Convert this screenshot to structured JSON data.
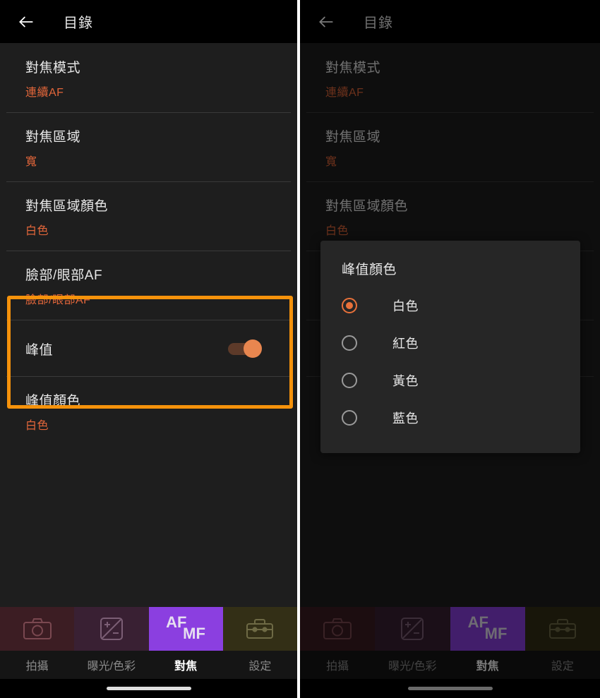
{
  "appbar": {
    "back_icon": "arrow-left-icon",
    "title": "目錄"
  },
  "settings_rows": [
    {
      "title": "對焦模式",
      "value": "連續AF",
      "type": "value"
    },
    {
      "title": "對焦區域",
      "value": "寬",
      "type": "value"
    },
    {
      "title": "對焦區域顏色",
      "value": "白色",
      "type": "value"
    },
    {
      "title": "臉部/眼部AF",
      "value": "臉部/眼部AF",
      "type": "value"
    },
    {
      "title": "峰值",
      "value": "",
      "type": "toggle",
      "toggle_on": true
    },
    {
      "title": "峰值顏色",
      "value": "白色",
      "type": "value"
    }
  ],
  "highlight": {
    "color": "#f5920b",
    "covers": [
      "峰值",
      "峰值顏色"
    ]
  },
  "dialog": {
    "title": "峰值顏色",
    "options": [
      {
        "label": "白色",
        "selected": true
      },
      {
        "label": "紅色",
        "selected": false
      },
      {
        "label": "黃色",
        "selected": false
      },
      {
        "label": "藍色",
        "selected": false
      }
    ],
    "accent": "#e8713a"
  },
  "bottomnav": {
    "tabs": [
      {
        "label": "拍攝",
        "icon": "camera-icon",
        "tile_color": "#3c1d23",
        "active": false
      },
      {
        "label": "曝光/色彩",
        "icon": "exposure-icon",
        "tile_color": "#392033",
        "active": false
      },
      {
        "label": "對焦",
        "icon": "af-mf-icon",
        "tile_color": "#8b3fe0",
        "active": true
      },
      {
        "label": "設定",
        "icon": "toolbox-icon",
        "tile_color": "#332f16",
        "active": false
      }
    ],
    "af_text_top": "AF",
    "af_text_bottom": "MF"
  },
  "colors": {
    "accent_orange": "#e2663a",
    "highlight_orange": "#f5920b",
    "toggle_thumb": "#e8864f",
    "toggle_track": "#5d3a29",
    "panel_bg": "#1e1e1e",
    "appbar_bg": "#000000",
    "dialog_bg": "#262626"
  }
}
